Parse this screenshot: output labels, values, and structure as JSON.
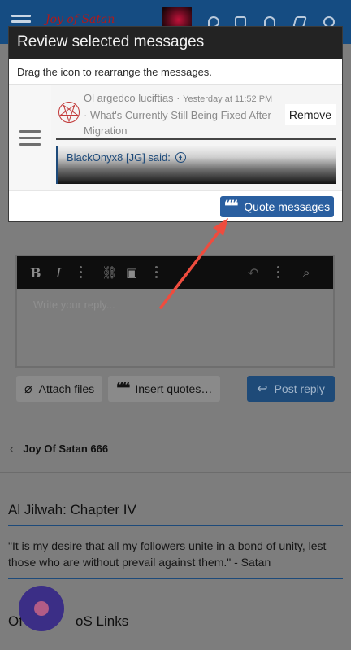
{
  "topbar": {
    "logo_text": "Joy of Satan"
  },
  "modal": {
    "title": "Review selected messages",
    "hint": "Drag the icon to rearrange the messages.",
    "message": {
      "author": "Ol argedco luciftias",
      "separator": " · ",
      "time": "Yesterday at 11:52 PM",
      "thread": "· What's Currently Still Being Fixed After Migration",
      "remove_label": "Remove",
      "quote_attribution": "BlackOnyx8 [JG] said:"
    },
    "quote_button_label": "Quote messages"
  },
  "editor": {
    "placeholder": "Write your reply..."
  },
  "actions": {
    "attach_label": "Attach files",
    "insert_quotes_label": "Insert quotes…",
    "post_reply_label": "Post reply"
  },
  "breadcrumb": {
    "label": "Joy Of Satan 666"
  },
  "widgets": {
    "quote_title": "Al Jilwah: Chapter IV",
    "quote_body": "\"It is my desire that all my followers unite in a bond of unity, lest those who are without prevail against them.\" - Satan",
    "links_title_partial": "Of",
    "links_title_rest": "oS Links"
  },
  "colors": {
    "accent": "#2a5fa0",
    "modal_header": "#232323",
    "arrow": "#ee4c3e"
  }
}
